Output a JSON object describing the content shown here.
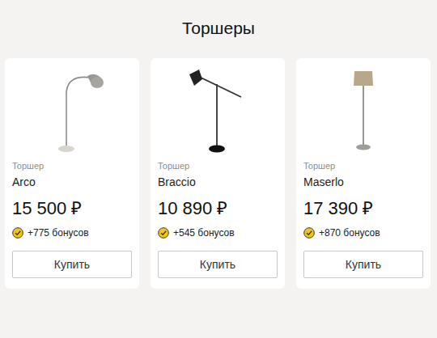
{
  "page": {
    "title": "Торшеры"
  },
  "products": [
    {
      "category": "Торшер",
      "name": "Arco",
      "price": "15 500 ₽",
      "bonus": "+775 бонусов",
      "button": "Купить",
      "kind": "arc"
    },
    {
      "category": "Торшер",
      "name": "Braccio",
      "price": "10 890 ₽",
      "bonus": "+545 бонусов",
      "button": "Купить",
      "kind": "boom"
    },
    {
      "category": "Торшер",
      "name": "Maserlo",
      "price": "17 390 ₽",
      "bonus": "+870 бонусов",
      "button": "Купить",
      "kind": "shade"
    }
  ]
}
